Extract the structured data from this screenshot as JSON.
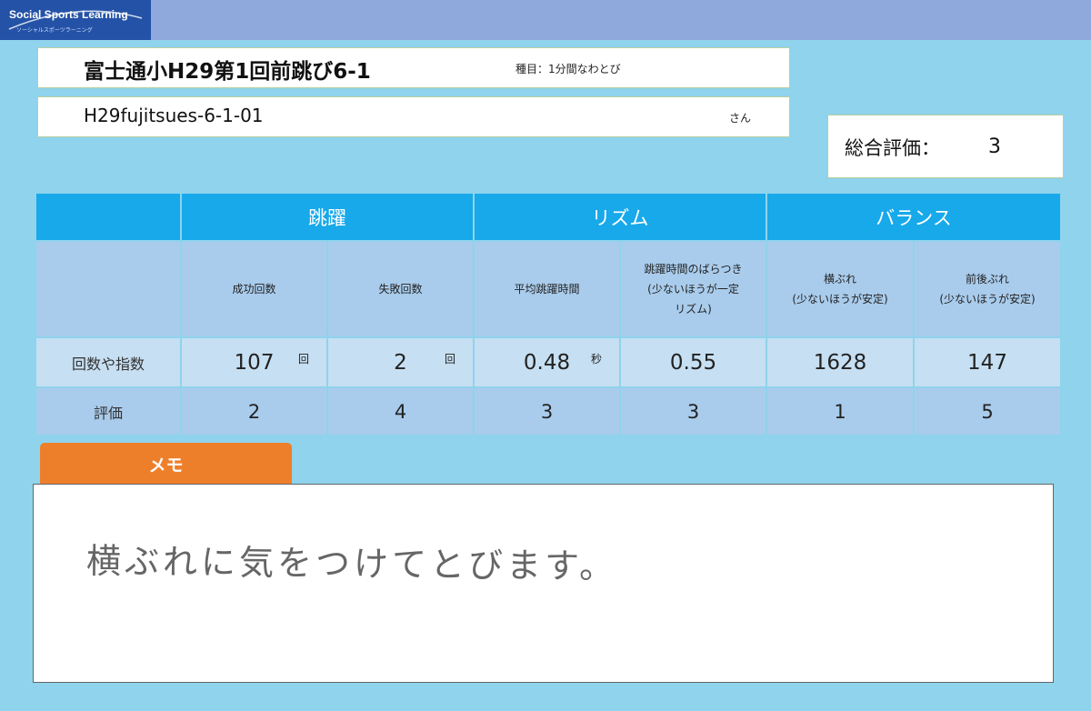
{
  "brand": {
    "name": "Social Sports Learning",
    "subtitle": "ソーシャルスポーツラーニング"
  },
  "header": {
    "title": "富士通小H29第1回前跳び6-1",
    "event": "種目：1分間なわとび",
    "user_id": "H29fujitsues-6-1-01",
    "user_suffix": "さん",
    "overall_label": "総合評価：",
    "overall_value": "3"
  },
  "table": {
    "groups": [
      "跳躍",
      "リズム",
      "バランス"
    ],
    "columns": [
      {
        "label": "成功回数",
        "count": "107",
        "unit": "回",
        "rating": "2"
      },
      {
        "label": "失敗回数",
        "count": "2",
        "unit": "回",
        "rating": "4"
      },
      {
        "label": "平均跳躍時間",
        "count": "0.48",
        "unit": "秒",
        "rating": "3"
      },
      {
        "label": "跳躍時間のばらつき\n(少ないほうが一定\nリズム)",
        "count": "0.55",
        "unit": "",
        "rating": "3"
      },
      {
        "label": "横ぶれ\n(少ないほうが安定)",
        "count": "1628",
        "unit": "",
        "rating": "1"
      },
      {
        "label": "前後ぶれ\n(少ないほうが安定)",
        "count": "147",
        "unit": "",
        "rating": "5"
      }
    ],
    "row_labels": {
      "count": "回数や指数",
      "rating": "評価"
    }
  },
  "memo": {
    "tab_label": "メモ",
    "text": "横ぶれに気をつけてとびます。"
  },
  "colors": {
    "background": "#8fd3ec",
    "topbar": "#8fa9dc",
    "logo": "#2452a6",
    "header_cell": "#17a9ea",
    "memo_tab": "#ee7f2a"
  }
}
